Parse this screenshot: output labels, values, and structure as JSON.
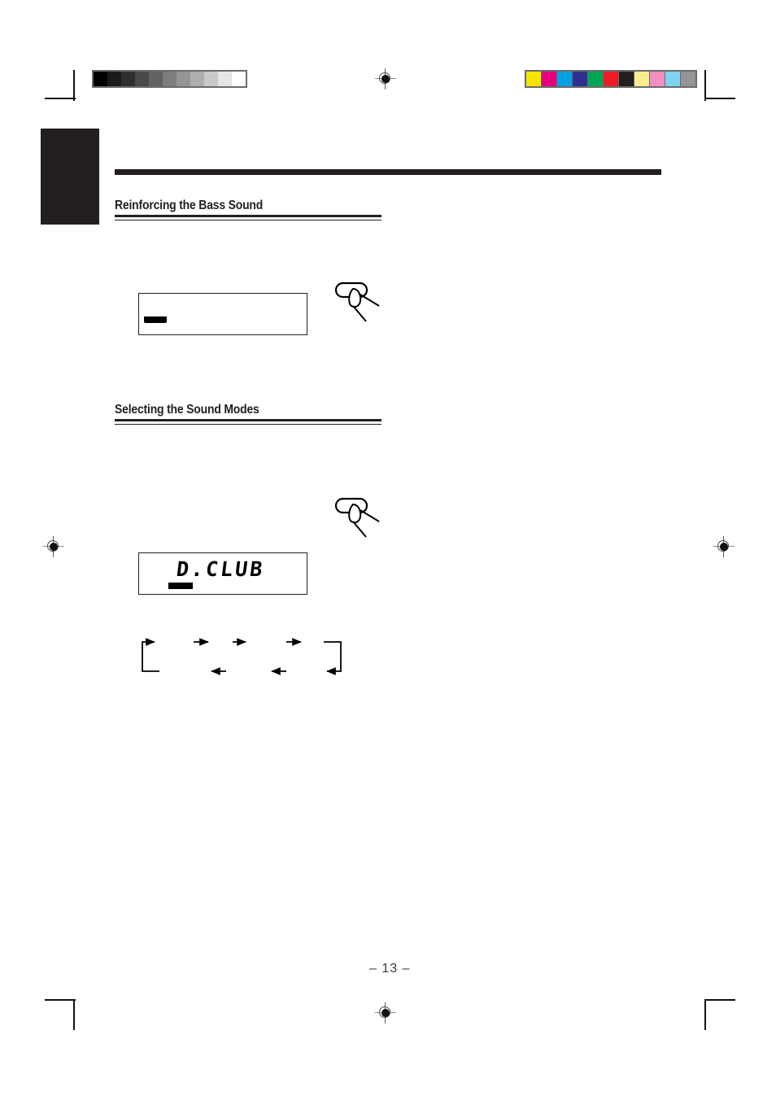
{
  "page": {
    "number_label": "– 13 –"
  },
  "sections": [
    {
      "id": "bass",
      "heading": "Reinforcing the Bass Sound"
    },
    {
      "id": "sound-modes",
      "heading": "Selecting the Sound Modes"
    }
  ],
  "displays": [
    {
      "id": "bass-display",
      "lcd_text": "",
      "indicator": "bass-indicator-bar"
    },
    {
      "id": "sound-mode-display",
      "lcd_text": "D.CLUB",
      "indicator": "sound-mode-indicator-bar"
    }
  ],
  "icons": {
    "press_button": "finger-press-button-icon",
    "registration": "registration-target-icon"
  },
  "flow": {
    "type": "cycle-loop",
    "forward_arrows": 4,
    "reverse_arrows": 3,
    "direction_forward": "right",
    "direction_reverse": "left"
  },
  "calibration": {
    "grayscale_label": "grayscale-calibration-strip",
    "grayscale_swatches": [
      "#000000",
      "#1c1a1b",
      "#2f2d2e",
      "#4a4849",
      "#636162",
      "#7e7c7d",
      "#969495",
      "#b0aeaf",
      "#cac8c9",
      "#e6e4e5",
      "#ffffff"
    ],
    "color_label": "color-calibration-strip",
    "color_swatches": [
      "#f5e500",
      "#e6007e",
      "#00a0e3",
      "#2e3192",
      "#00a651",
      "#ed1c24",
      "#231f20",
      "#faed8f",
      "#f58ec1",
      "#7fd4f2",
      "#939598"
    ]
  }
}
